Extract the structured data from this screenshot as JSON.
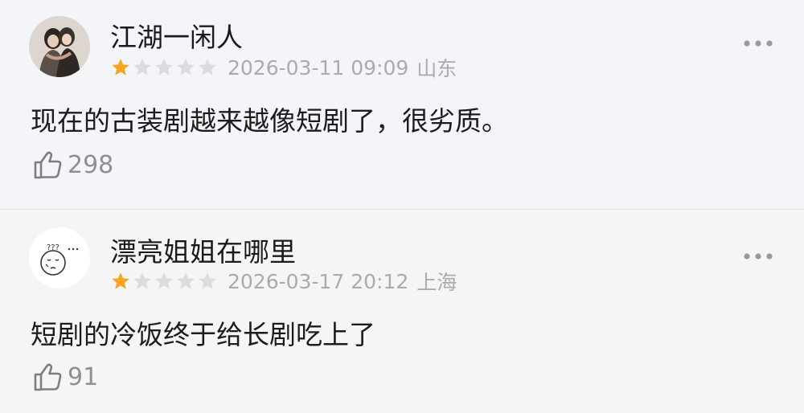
{
  "comments": [
    {
      "username": "江湖一闲人",
      "avatar": "photo-avatar",
      "rating": 1,
      "rating_max": 5,
      "datetime": "2026-03-11 09:09",
      "region": "山东",
      "content": "现在的古装剧越来越像短剧了，很劣质。",
      "likes": "298"
    },
    {
      "username": "漂亮姐姐在哪里",
      "avatar": "cartoon-face-avatar",
      "rating": 1,
      "rating_max": 5,
      "datetime": "2026-03-17 20:12",
      "region": "上海",
      "content": "短剧的冷饭终于给长剧吃上了",
      "likes": "91"
    }
  ],
  "colors": {
    "star_filled": "#f6a623",
    "star_empty": "#dcdce0",
    "meta_text": "#ababaf",
    "like_text": "#8f8f93"
  }
}
